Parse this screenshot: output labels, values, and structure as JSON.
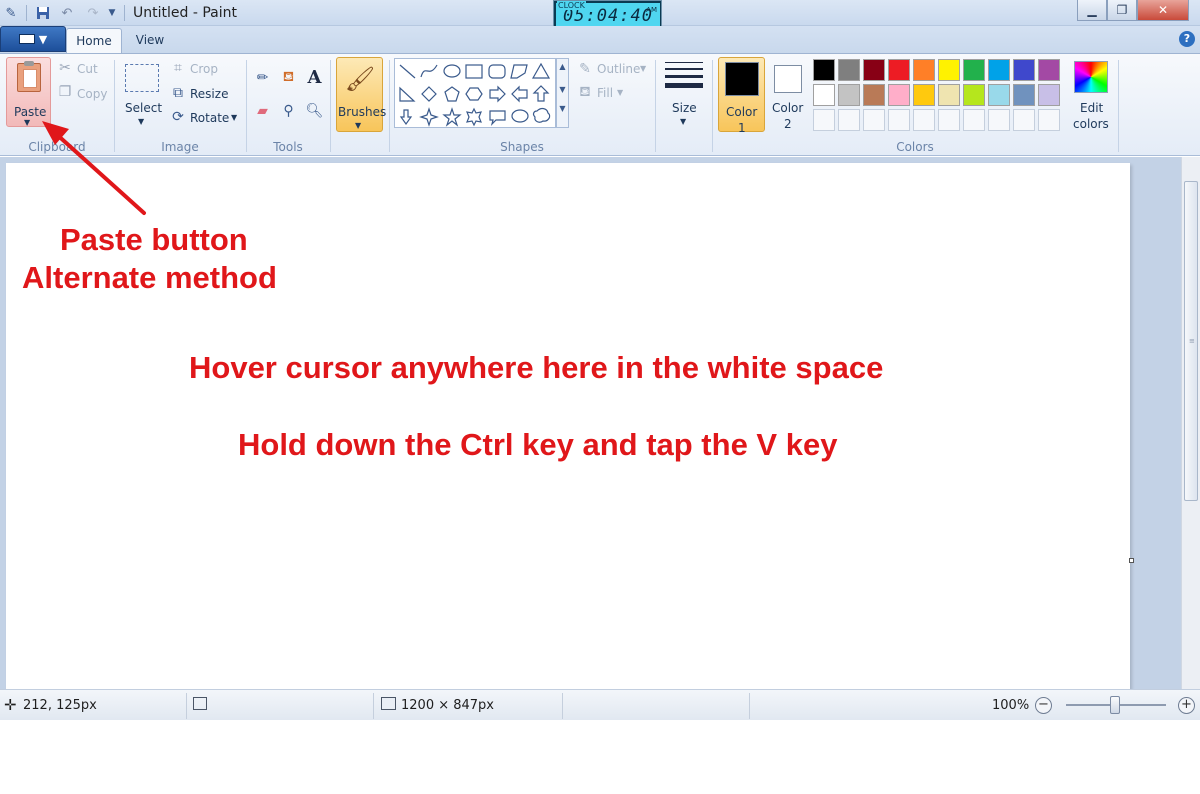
{
  "window": {
    "title": "Untitled - Paint",
    "clock_label": "CLOCK",
    "clock_time": "05:04:40",
    "clock_ampm": "AM"
  },
  "tabs": {
    "home": "Home",
    "view": "View"
  },
  "ribbon": {
    "clipboard": {
      "label": "Clipboard",
      "paste": "Paste",
      "cut": "Cut",
      "copy": "Copy"
    },
    "image": {
      "label": "Image",
      "select": "Select",
      "crop": "Crop",
      "resize": "Resize",
      "rotate": "Rotate"
    },
    "tools": {
      "label": "Tools"
    },
    "brushes": {
      "label": "Brushes"
    },
    "shapes": {
      "label": "Shapes",
      "outline": "Outline",
      "fill": "Fill"
    },
    "size": {
      "label": "Size"
    },
    "colors": {
      "label": "Colors",
      "color1_line1": "Color",
      "color1_line2": "1",
      "color2_line1": "Color",
      "color2_line2": "2",
      "edit_line1": "Edit",
      "edit_line2": "colors",
      "color1_value": "#000000",
      "color2_value": "#ffffff",
      "palette_row1": [
        "#000000",
        "#7f7f7f",
        "#880015",
        "#ed1c24",
        "#ff7f27",
        "#fff200",
        "#22b14c",
        "#00a2e8",
        "#3f48cc",
        "#a349a4"
      ],
      "palette_row2": [
        "#ffffff",
        "#c3c3c3",
        "#b97a57",
        "#ffaec9",
        "#ffc90e",
        "#efe4b0",
        "#b5e61d",
        "#99d9ea",
        "#7092be",
        "#c8bfe7"
      ]
    }
  },
  "annotations": {
    "paste_line1": "Paste button",
    "paste_line2": "Alternate method",
    "hover": "Hover cursor anywhere here in the white space",
    "hold": "Hold down the Ctrl key and tap the V key",
    "color": "#e0171a"
  },
  "status": {
    "cursor_pos": "212, 125px",
    "canvas_size": "1200 × 847px",
    "zoom": "100%"
  }
}
